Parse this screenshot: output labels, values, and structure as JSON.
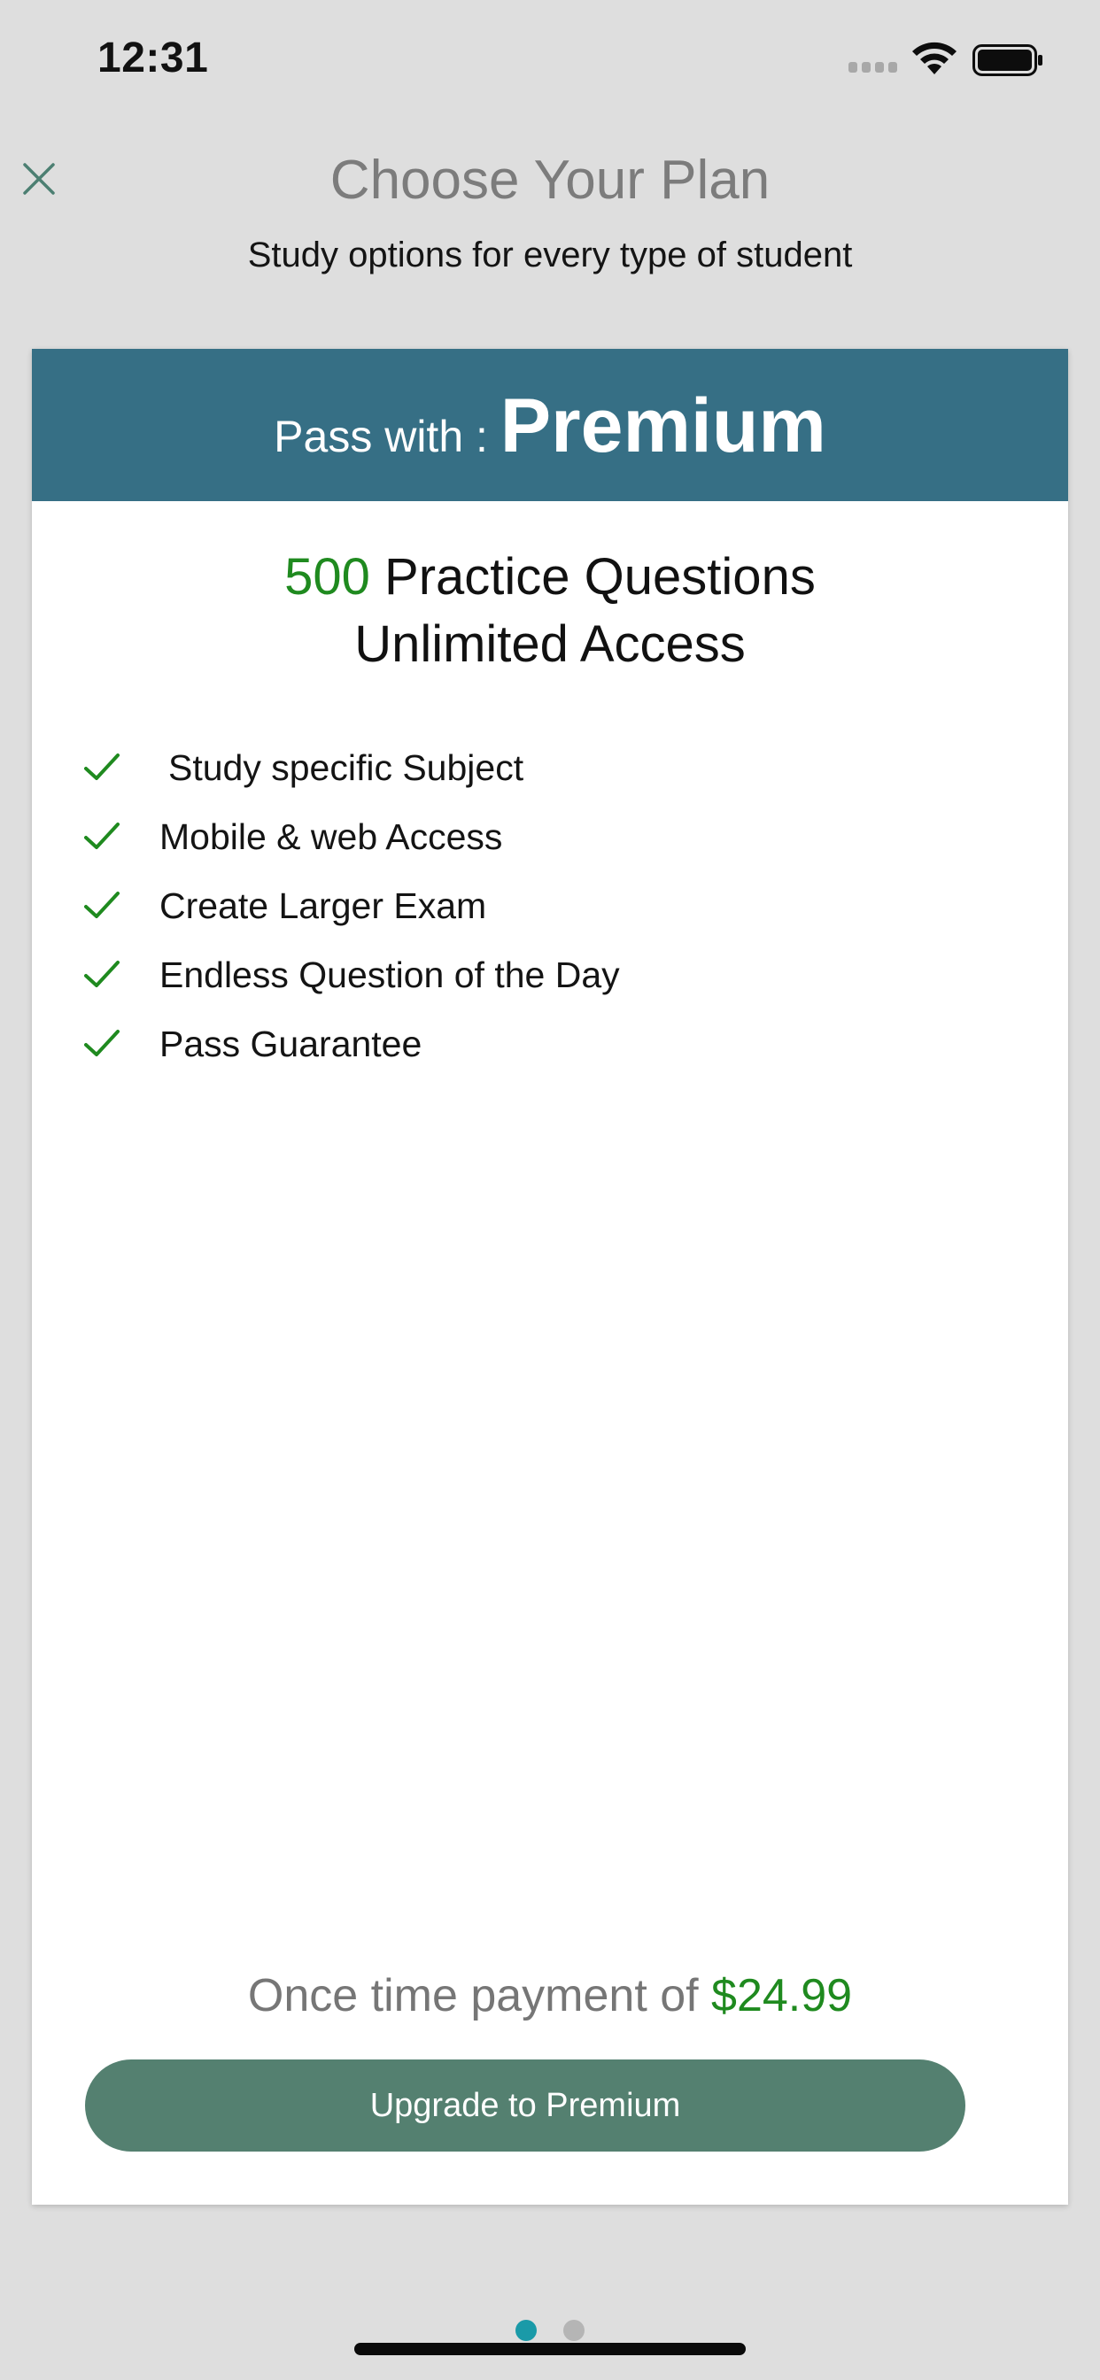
{
  "status_bar": {
    "time": "12:31",
    "signal_icon": "cellular-signal-icon",
    "wifi_icon": "wifi-icon",
    "battery_icon": "battery-icon"
  },
  "header": {
    "close_icon": "close-icon",
    "title": "Choose Your Plan",
    "subtitle": "Study options for every type of student"
  },
  "plan": {
    "header_prefix": "Pass with : ",
    "header_name": "Premium",
    "question_count": "500",
    "headline_rest": " Practice Questions",
    "headline_line2": "Unlimited Access",
    "features": [
      {
        "label": "Study specific Subject",
        "icon": "checkmark-icon"
      },
      {
        "label": "Mobile & web Access",
        "icon": "checkmark-icon"
      },
      {
        "label": "Create Larger Exam",
        "icon": "checkmark-icon"
      },
      {
        "label": "Endless Question of the Day",
        "icon": "checkmark-icon"
      },
      {
        "label": "Pass Guarantee",
        "icon": "checkmark-icon"
      }
    ],
    "price_prefix": "Once time payment of ",
    "price": "$24.99",
    "cta_label": "Upgrade to Premium"
  },
  "pagination": {
    "total_pages": 2,
    "current_page": 1
  },
  "colors": {
    "header_bg": "#366f85",
    "accent_green": "#1f8a1f",
    "button_bg": "#548070",
    "active_dot": "#1a9aa8",
    "inactive_dot": "#b5b5b5",
    "page_bg": "#dedede"
  }
}
